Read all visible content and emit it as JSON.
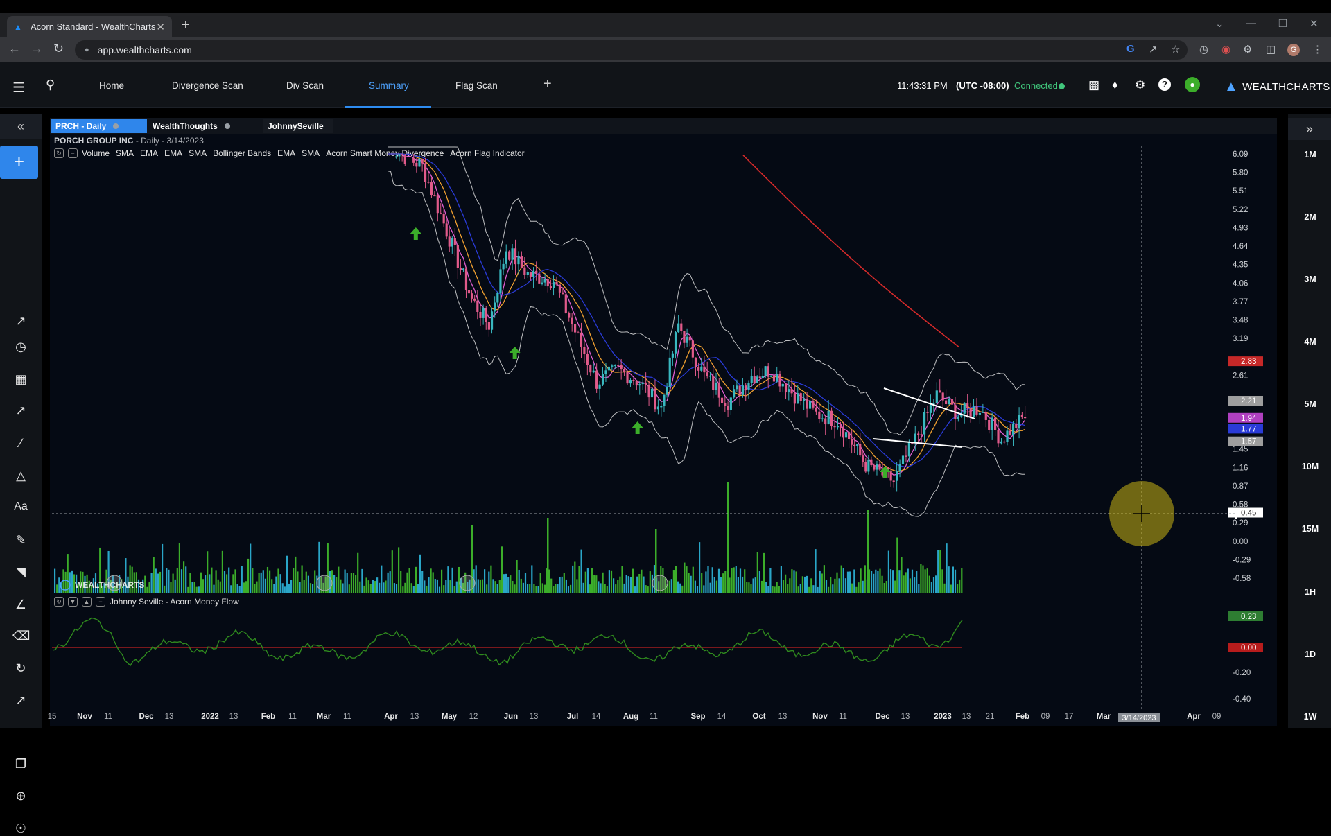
{
  "browser": {
    "tab_title": "Acorn Standard - WealthCharts",
    "url": "app.wealthcharts.com"
  },
  "header": {
    "tabs": [
      {
        "label": "Home"
      },
      {
        "label": "Divergence Scan"
      },
      {
        "label": "Div Scan"
      },
      {
        "label": "Summary"
      },
      {
        "label": "Flag Scan"
      }
    ],
    "active_tab": "Summary",
    "time": "11:43:31 PM",
    "timezone": "(UTC -08:00)",
    "connection": "Connected",
    "brand": "WEALTHCHARTS"
  },
  "chart_tabs": [
    {
      "label": "PRCH - Daily"
    },
    {
      "label": "WealthThoughts"
    },
    {
      "label": "JohnnySeville"
    }
  ],
  "stock": {
    "name": "PORCH GROUP INC",
    "detail": "- Daily - 3/14/2023"
  },
  "indicators": [
    "Volume",
    "SMA",
    "EMA",
    "EMA",
    "SMA",
    "Bollinger Bands",
    "EMA",
    "SMA",
    "Acorn Smart Money Divergence",
    "Acorn Flag Indicator"
  ],
  "money_flow_label": "Johnny Seville - Acorn Money Flow",
  "watermark": "WEALTHCHARTS",
  "timeframes": [
    "1M",
    "2M",
    "3M",
    "4M",
    "5M",
    "10M",
    "15M",
    "1H",
    "1D",
    "1W"
  ],
  "colors": {
    "accent": "#2f86eb",
    "connected": "#41c77c",
    "sma200": "#d42a2a",
    "bollinger": "#e0e0e0",
    "ema_fast": "#e05fd0",
    "ema_mid": "#f0a030",
    "ema_slow": "#2a3bd8",
    "candle_up": "#39b8c0",
    "candle_down": "#e05a8a",
    "volume_up": "#3cae2a",
    "volume_down": "#2aa6c8",
    "money_flow": "#2f8a1e",
    "zero_line": "#c02020"
  },
  "chart_data": {
    "type": "candlestick",
    "symbol": "PRCH",
    "interval": "Daily",
    "price_axis": [
      "6.09",
      "5.80",
      "5.51",
      "5.22",
      "4.93",
      "4.64",
      "4.35",
      "4.06",
      "3.77",
      "3.48",
      "3.19",
      "2.61",
      "1.45",
      "1.16",
      "0.87",
      "0.58",
      "0.29",
      "0.00",
      "-0.29",
      "-0.58"
    ],
    "price_labels": [
      {
        "value": "2.83",
        "color": "#c62828"
      },
      {
        "value": "2.21",
        "color": "#9e9e9e"
      },
      {
        "value": "1.94",
        "color": "#b040c0"
      },
      {
        "value": "1.77",
        "color": "#2a3bd8"
      },
      {
        "value": "1.57",
        "color": "#9e9e9e"
      },
      {
        "value": "0.45",
        "color": "#ffffff"
      }
    ],
    "money_flow_axis": [
      "-0.20",
      "-0.40"
    ],
    "money_flow_labels": [
      {
        "value": "0.23",
        "color": "#2e7d32"
      },
      {
        "value": "0.00",
        "color": "#b71c1c"
      }
    ],
    "time_axis": [
      "15",
      "Nov",
      "11",
      "Dec",
      "13",
      "2022",
      "13",
      "Feb",
      "11",
      "Mar",
      "11",
      "Apr",
      "13",
      "May",
      "12",
      "Jun",
      "13",
      "Jul",
      "14",
      "Aug",
      "11",
      "Sep",
      "14",
      "Oct",
      "13",
      "Nov",
      "11",
      "Dec",
      "13",
      "2023",
      "13",
      "21",
      "Feb",
      "09",
      "17",
      "Mar",
      "Apr",
      "09"
    ],
    "cursor_date": "3/14/2023",
    "price_path": [
      {
        "x": "2022-03-20",
        "close": 6.2
      },
      {
        "x": "2022-04-05",
        "close": 5.9
      },
      {
        "x": "2022-04-15",
        "close": 5.0
      },
      {
        "x": "2022-04-28",
        "close": 3.8
      },
      {
        "x": "2022-05-06",
        "close": 3.4
      },
      {
        "x": "2022-05-14",
        "close": 4.6
      },
      {
        "x": "2022-05-24",
        "close": 4.2
      },
      {
        "x": "2022-06-05",
        "close": 4.1
      },
      {
        "x": "2022-06-15",
        "close": 3.3
      },
      {
        "x": "2022-06-25",
        "close": 2.5
      },
      {
        "x": "2022-07-05",
        "close": 2.7
      },
      {
        "x": "2022-07-15",
        "close": 2.5
      },
      {
        "x": "2022-07-25",
        "close": 2.1
      },
      {
        "x": "2022-08-02",
        "close": 3.4
      },
      {
        "x": "2022-08-14",
        "close": 2.6
      },
      {
        "x": "2022-08-25",
        "close": 2.2
      },
      {
        "x": "2022-09-05",
        "close": 2.6
      },
      {
        "x": "2022-09-14",
        "close": 2.7
      },
      {
        "x": "2022-09-25",
        "close": 2.3
      },
      {
        "x": "2022-10-05",
        "close": 2.0
      },
      {
        "x": "2022-10-15",
        "close": 1.9
      },
      {
        "x": "2022-10-28",
        "close": 1.2
      },
      {
        "x": "2022-11-10",
        "close": 0.95
      },
      {
        "x": "2022-11-20",
        "close": 1.6
      },
      {
        "x": "2022-11-30",
        "close": 2.3
      },
      {
        "x": "2022-12-10",
        "close": 2.0
      },
      {
        "x": "2022-12-20",
        "close": 2.1
      },
      {
        "x": "2022-12-30",
        "close": 1.6
      },
      {
        "x": "2023-01-10",
        "close": 1.97
      }
    ],
    "flag_arrow_dates": [
      "2022-04-02",
      "2022-05-18",
      "2022-07-14",
      "2022-11-06"
    ]
  }
}
